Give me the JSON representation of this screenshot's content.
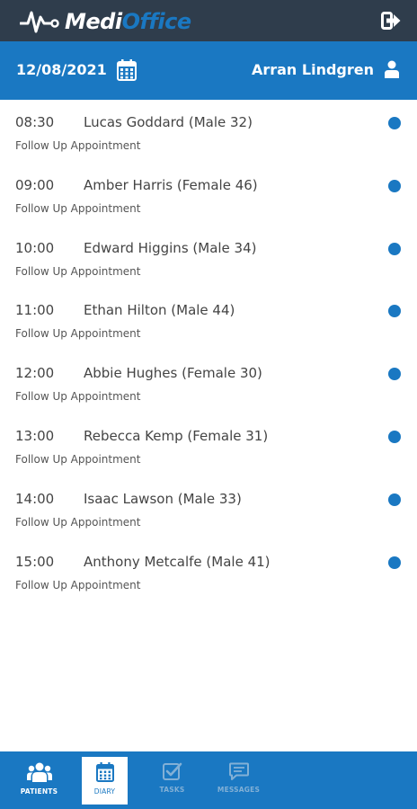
{
  "app": {
    "logo_medi": "Medi",
    "logo_office": "Office",
    "logo_icon": "heartbeat-icon",
    "logout_icon": "logout-icon"
  },
  "header": {
    "date": "12/08/2021",
    "calendar_icon": "calendar-icon",
    "user_name": "Arran Lindgren",
    "user_icon": "user-icon"
  },
  "appointments": [
    {
      "time": "08:30",
      "patient": "Lucas Goddard (Male 32)",
      "type": "Follow Up Appointment"
    },
    {
      "time": "09:00",
      "patient": "Amber Harris (Female 46)",
      "type": "Follow Up Appointment"
    },
    {
      "time": "10:00",
      "patient": "Edward Higgins (Male 34)",
      "type": "Follow Up Appointment"
    },
    {
      "time": "11:00",
      "patient": "Ethan Hilton (Male 44)",
      "type": "Follow Up Appointment"
    },
    {
      "time": "12:00",
      "patient": "Abbie Hughes (Female 30)",
      "type": "Follow Up Appointment"
    },
    {
      "time": "13:00",
      "patient": "Rebecca Kemp (Female 31)",
      "type": "Follow Up Appointment"
    },
    {
      "time": "14:00",
      "patient": "Isaac Lawson (Male 33)",
      "type": "Follow Up Appointment"
    },
    {
      "time": "15:00",
      "patient": "Anthony Metcalfe (Male 41)",
      "type": "Follow Up Appointment"
    }
  ],
  "tabs": [
    {
      "label": "PATIENTS",
      "icon": "patients-icon"
    },
    {
      "label": "DIARY",
      "icon": "calendar-icon",
      "active": true
    },
    {
      "label": "TASKS",
      "icon": "tasks-icon"
    },
    {
      "label": "MESSAGES",
      "icon": "messages-icon"
    }
  ],
  "colors": {
    "topbar": "#2f3d4c",
    "brand_blue": "#1a78c2",
    "status_dot": "#1a78c2"
  }
}
